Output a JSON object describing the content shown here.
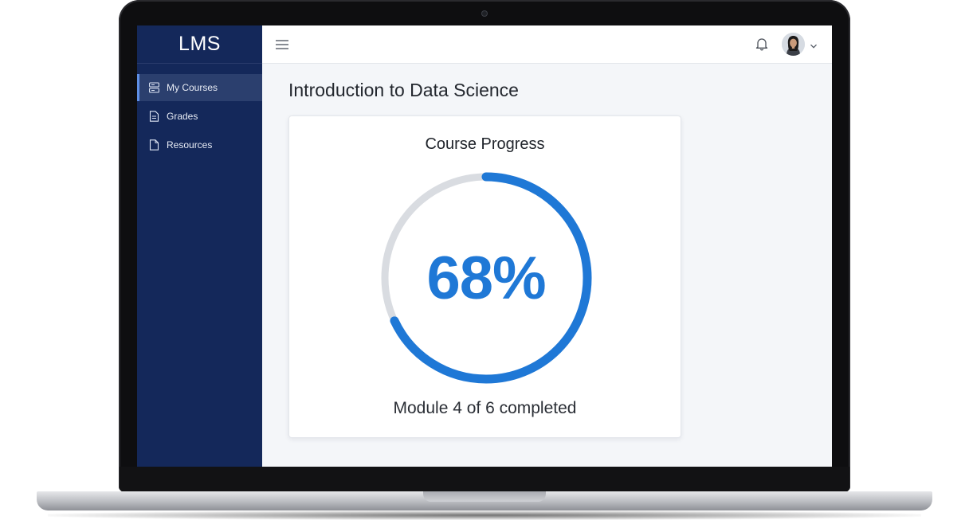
{
  "app": {
    "logo": "LMS"
  },
  "sidebar": {
    "items": [
      {
        "label": "My Courses",
        "icon": "courses-icon",
        "active": true
      },
      {
        "label": "Grades",
        "icon": "document-icon",
        "active": false
      },
      {
        "label": "Resources",
        "icon": "file-icon",
        "active": false
      }
    ]
  },
  "topbar": {
    "menu_icon": "hamburger-menu-icon",
    "notification_icon": "bell-icon",
    "profile_icon": "avatar",
    "dropdown_icon": "chevron-down-icon"
  },
  "main": {
    "page_title": "Introduction to Data Science",
    "progress_card": {
      "title": "Course Progress",
      "percent_label": "68%",
      "progress_fraction": 0.68,
      "status_text": "Module 4 of 6 completed"
    }
  },
  "colors": {
    "sidebar_bg": "#14285a",
    "sidebar_active": "#2b3f6e",
    "accent": "#1f78d6",
    "ring_track": "#d9dce1",
    "page_bg": "#f4f6f9"
  }
}
